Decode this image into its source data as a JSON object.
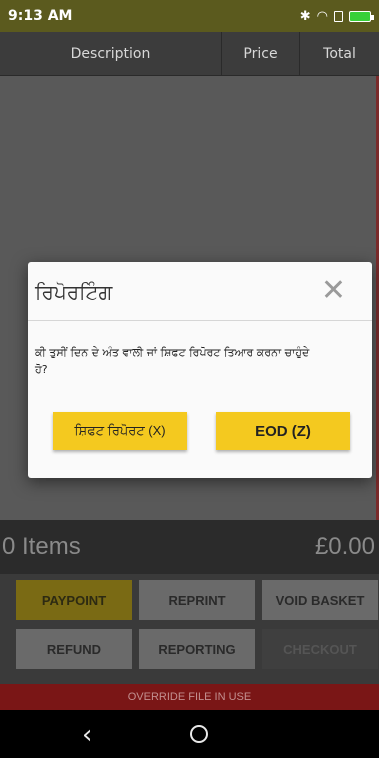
{
  "status_bar": {
    "time": "9:13 AM",
    "bluetooth_icon": "bluetooth-icon",
    "wifi_icon": "wifi-icon",
    "battery_icon": "battery-icon",
    "battery_color": "#37d038"
  },
  "table_header": {
    "description": "Description",
    "price": "Price",
    "total": "Total"
  },
  "totals": {
    "items": "0 Items",
    "amount": "£0.00"
  },
  "buttons": {
    "paypoint": "PAYPOINT",
    "reprint": "REPRINT",
    "void_basket": "VOID BASKET",
    "refund": "REFUND",
    "reporting": "REPORTING",
    "checkout": "CHECKOUT"
  },
  "override_bar": {
    "text": "OVERRIDE FILE IN USE"
  },
  "dialog": {
    "title": "ਰਿਪੋਰਟਿੰਗ",
    "close_icon": "close-icon",
    "message": "ਕੀ ਤੁਸੀਂ ਦਿਨ ਦੇ ਅੰਤ ਵਾਲੀ ਜਾਂ ਸ਼ਿਫਟ ਰਿਪੋਰਟ ਤਿਆਰ ਕਰਨਾ ਚਾਹੁੰਦੇ ਹੋ?",
    "shift_button": "ਸ਼ਿਫਟ ਰਿਪੋਰਟ (X)",
    "eod_button": "EOD (Z)"
  },
  "nav_bar": {
    "back_icon": "back-icon",
    "home_icon": "home-icon"
  },
  "colors": {
    "accent": "#f4c91f",
    "override_red": "#7a1616"
  }
}
